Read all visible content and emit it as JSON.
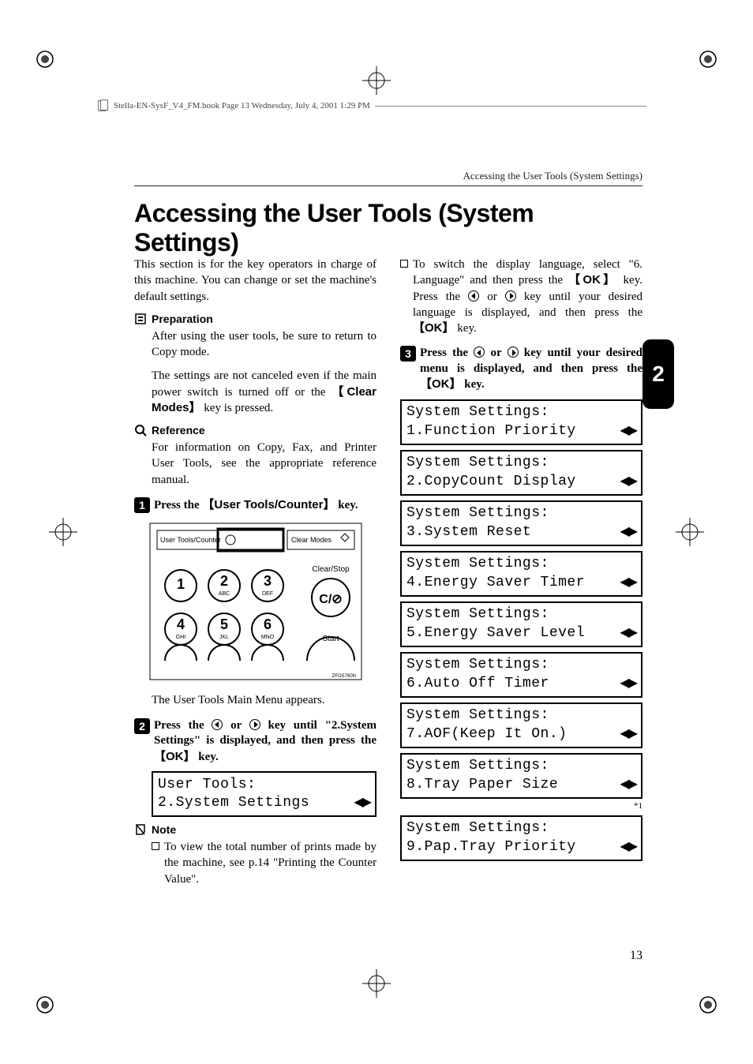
{
  "header_book_line": "Stella-EN-SysF_V4_FM.book  Page 13  Wednesday, July 4, 2001  1:29 PM",
  "running_head": "Accessing the User Tools (System Settings)",
  "title": "Accessing the User Tools (System Settings)",
  "side_tab": "2",
  "page_number": "13",
  "left": {
    "intro": "This section is for the key operators in charge of this machine. You can change or set the machine's default settings.",
    "preparation_label": "Preparation",
    "prep_p1": "After using the user tools, be sure to return to Copy mode.",
    "prep_p2_a": "The settings are not canceled even if the main power switch is turned off or the ",
    "prep_key": "Clear Modes",
    "prep_p2_b": " key is pressed.",
    "reference_label": "Reference",
    "ref_p": "For information on Copy, Fax, and Printer User Tools, see the appropriate reference manual.",
    "step1_a": "Press the ",
    "step1_key": "User Tools/Counter",
    "step1_b": " key.",
    "keypad": {
      "top_left": "User Tools/Counter",
      "top_right": "Clear Modes",
      "clear_stop": "Clear/Stop",
      "start": "Start",
      "code": "ZFOS760N",
      "keys": [
        {
          "n": "1",
          "sub": ""
        },
        {
          "n": "2",
          "sub": "ABC"
        },
        {
          "n": "3",
          "sub": "DEF"
        },
        {
          "n": "4",
          "sub": "GHI"
        },
        {
          "n": "5",
          "sub": "JKL"
        },
        {
          "n": "6",
          "sub": "MNO"
        }
      ]
    },
    "after_fig": "The User Tools Main Menu appears.",
    "step2_a": "Press the ",
    "step2_b": " or ",
    "step2_c": " key until \"2.System Settings\" is displayed, and then press the ",
    "step2_key": "OK",
    "step2_d": " key.",
    "lcd_user_tools": {
      "l1": "User Tools:",
      "l2": "2.System Settings"
    },
    "note_label": "Note",
    "note1": "To view the total number of prints made by the machine, see p.14 \"Printing the Counter Value\"."
  },
  "right": {
    "note2_a": "To switch the display language, select \"6. Language\" and then press the ",
    "note2_key1": "OK",
    "note2_b": " key. Press the ",
    "note2_c": " or ",
    "note2_d": " key until your desired language is displayed, and then press the ",
    "note2_key2": "OK",
    "note2_e": " key.",
    "step3_a": "Press the ",
    "step3_b": " or ",
    "step3_c": " key until your desired menu is displayed, and then press the ",
    "step3_key": "OK",
    "step3_d": " key.",
    "lcds": [
      {
        "l1": "System Settings:",
        "l2": "1.Function Priority"
      },
      {
        "l1": "System Settings:",
        "l2": "2.CopyCount Display"
      },
      {
        "l1": "System Settings:",
        "l2": "3.System Reset"
      },
      {
        "l1": "System Settings:",
        "l2": "4.Energy Saver Timer"
      },
      {
        "l1": "System Settings:",
        "l2": "5.Energy Saver Level"
      },
      {
        "l1": "System Settings:",
        "l2": "6.Auto Off Timer"
      },
      {
        "l1": "System Settings:",
        "l2": "7.AOF(Keep It On.)"
      },
      {
        "l1": "System Settings:",
        "l2": "8.Tray Paper Size"
      },
      {
        "l1": "System Settings:",
        "l2": "9.Pap.Tray Priority"
      }
    ],
    "footnote": "*1"
  }
}
